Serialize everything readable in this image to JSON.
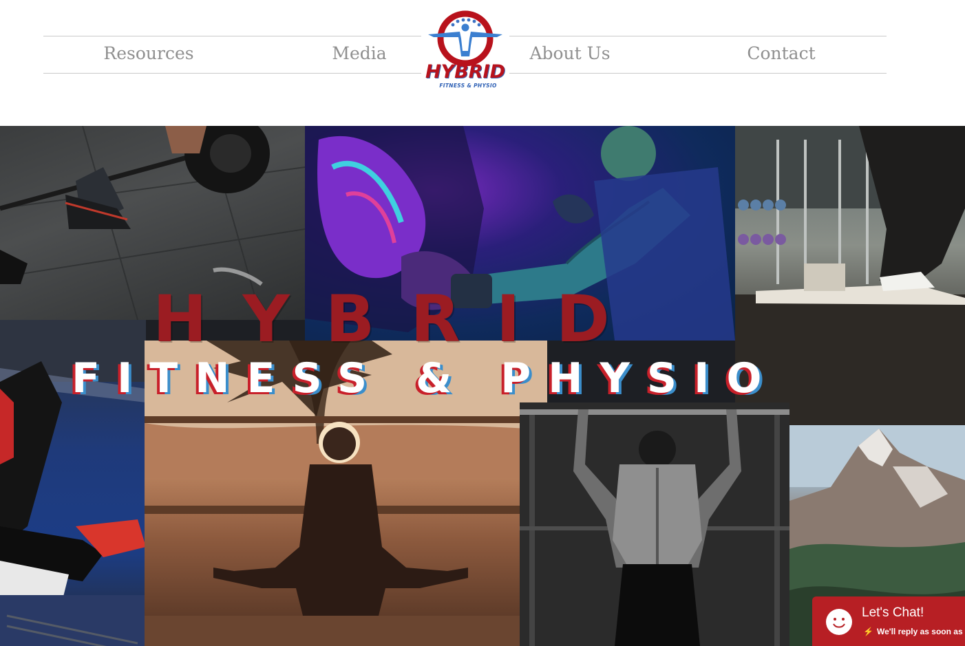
{
  "header": {
    "nav": [
      {
        "label": "Resources"
      },
      {
        "label": "Media"
      },
      {
        "label": "About Us"
      },
      {
        "label": "Contact"
      }
    ],
    "logo": {
      "word": "HYBRID",
      "sub": "FITNESS & PHYSIO",
      "icon": "flexing-figure-in-circle-icon"
    }
  },
  "hero": {
    "title": "HYBRID",
    "subtitle": "FITNESS & PHYSIO",
    "tiles": [
      {
        "name": "deadlift-photo"
      },
      {
        "name": "boxing-photo"
      },
      {
        "name": "box-jump-gym-photo"
      },
      {
        "name": "blue-floor-workout-photo"
      },
      {
        "name": "yoga-sunset-photo"
      },
      {
        "name": "pullup-photo"
      },
      {
        "name": "mountain-photo"
      }
    ]
  },
  "chat": {
    "title": "Let's Chat!",
    "subtitle": "We'll reply as soon as w",
    "icon": "smiley-icon",
    "accent": "#b71f24"
  },
  "colors": {
    "brand_red": "#9b1c22",
    "nav_text": "#8f8f8f",
    "brand_blue": "#2f61b5"
  }
}
